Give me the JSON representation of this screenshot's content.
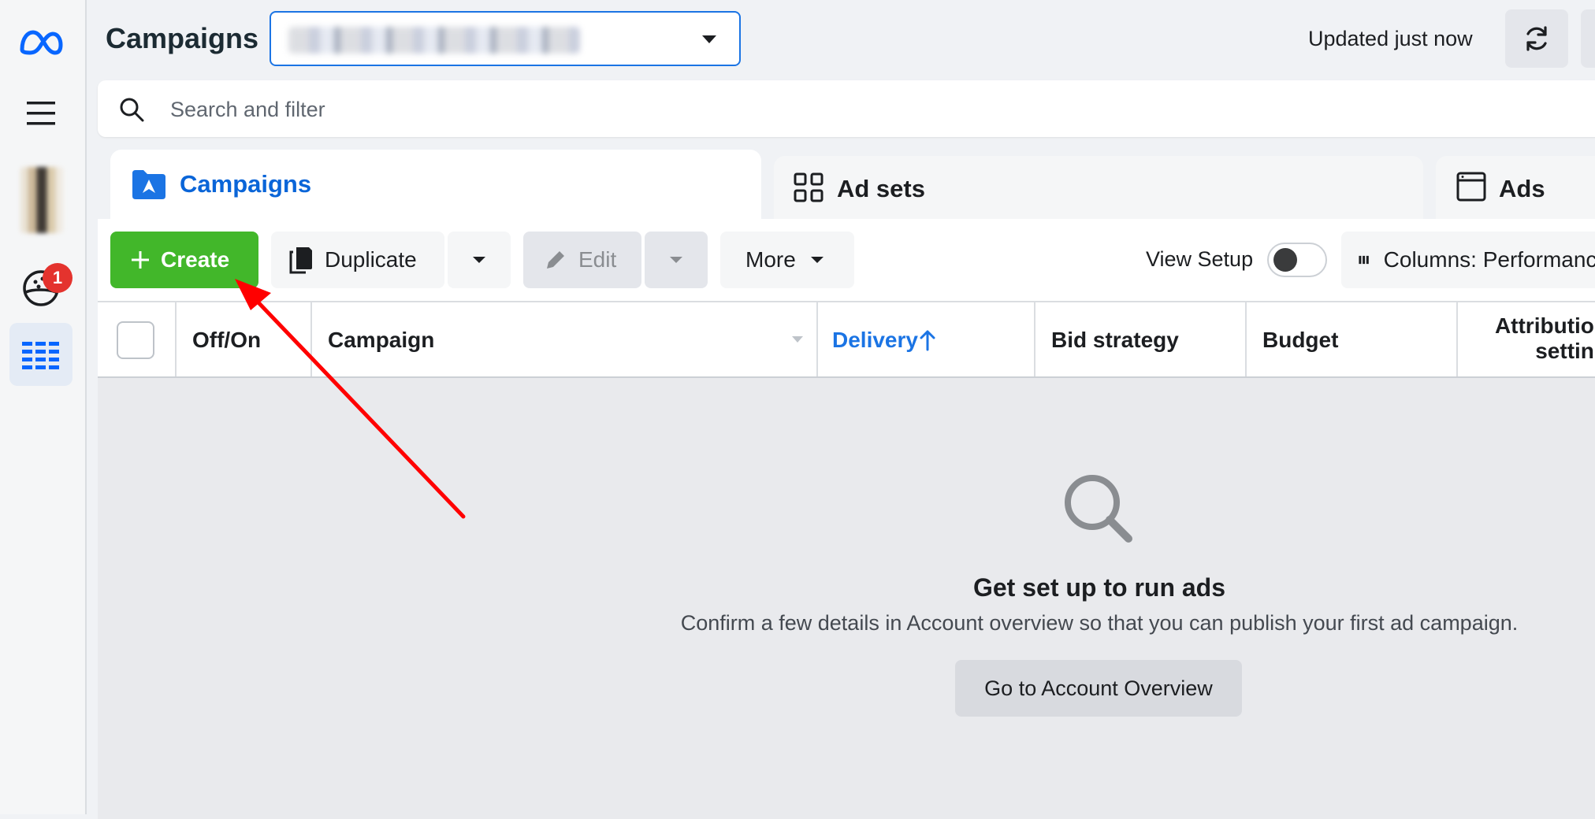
{
  "header": {
    "title": "Campaigns",
    "account_name": "(redacted)",
    "updated_text": "Updated just now"
  },
  "search": {
    "placeholder": "Search and filter"
  },
  "tabs": [
    {
      "label": "Campaigns",
      "active": true
    },
    {
      "label": "Ad sets",
      "active": false
    },
    {
      "label": "Ads",
      "active": false
    }
  ],
  "toolbar": {
    "create": "Create",
    "duplicate": "Duplicate",
    "edit": "Edit",
    "more": "More",
    "view_setup": "View Setup",
    "view_setup_on": false,
    "columns": "Columns: Performance"
  },
  "table": {
    "columns": [
      "Off/On",
      "Campaign",
      "Delivery",
      "Bid strategy",
      "Budget",
      "Attribution setting"
    ],
    "sorted_column": "Delivery",
    "sort_direction": "ascending"
  },
  "empty_state": {
    "title": "Get set up to run ads",
    "text": "Confirm a few details in Account overview so that you can publish your first ad campaign.",
    "button": "Go to Account Overview"
  },
  "sidebar": {
    "notification_count": "1"
  },
  "colors": {
    "brand_blue": "#0866ff",
    "create_green": "#42b72a",
    "annotation_red": "#ff0000",
    "badge_red": "#e4332e"
  },
  "icons": [
    "meta-logo-icon",
    "menu-icon",
    "notifications-icon",
    "ads-manager-table-icon",
    "refresh-icon",
    "search-icon",
    "campaign-folder-icon",
    "ad-sets-grid-icon",
    "ads-window-icon",
    "plus-icon",
    "duplicate-icon",
    "pencil-icon",
    "caret-down-icon",
    "columns-icon",
    "magnifier-icon",
    "sort-arrow-up-icon"
  ]
}
